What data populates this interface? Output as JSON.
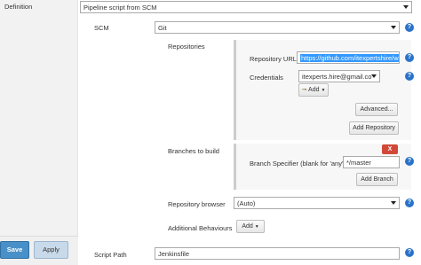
{
  "definition": {
    "label": "Definition",
    "value": "Pipeline script from SCM"
  },
  "scm": {
    "label": "SCM",
    "value": "Git"
  },
  "repositories": {
    "heading": "Repositories",
    "url_label": "Repository URL",
    "url_value": "https://github.com/itexpertshire/web",
    "credentials_label": "Credentials",
    "credentials_value": "itexperts.hire@gmail.co",
    "add_label": "Add",
    "advanced_label": "Advanced...",
    "add_repository_label": "Add Repository"
  },
  "branches": {
    "heading": "Branches to build",
    "delete_label": "X",
    "specifier_label": "Branch Specifier (blank for 'any')",
    "specifier_value": "*/master",
    "add_branch_label": "Add Branch"
  },
  "repository_browser": {
    "label": "Repository browser",
    "value": "(Auto)"
  },
  "additional_behaviours": {
    "label": "Additional Behaviours",
    "add_label": "Add"
  },
  "script_path": {
    "label": "Script Path",
    "value": "Jenkinsfile"
  },
  "footer": {
    "save_label": "Save",
    "apply_label": "Apply"
  },
  "help_glyph": "?",
  "colors": {
    "help_icon": "#2a72c9",
    "save_button": "#4a90c8",
    "delete_button": "#d24939",
    "selected_text": "#3399ff"
  }
}
